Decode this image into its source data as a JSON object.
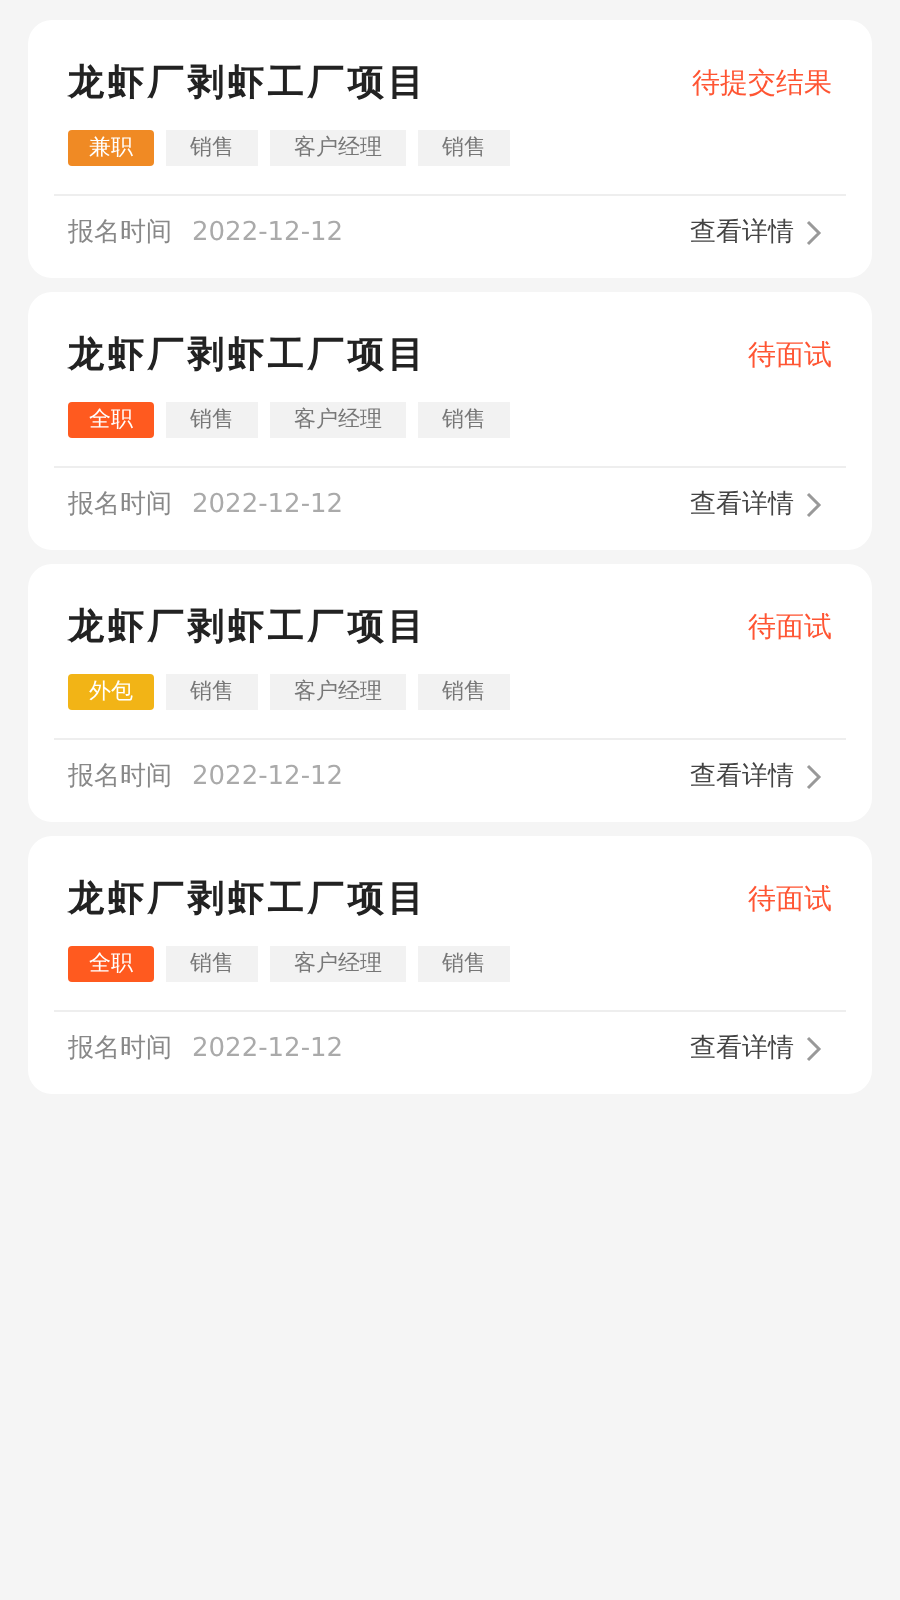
{
  "applications": [
    {
      "title": "龙虾厂剥虾工厂项目",
      "status": "待提交结果",
      "job_type": {
        "label": "兼职",
        "color": "#f08a24"
      },
      "tags": [
        "销售",
        "客户经理",
        "销售"
      ],
      "date_label": "报名时间",
      "date": "2022-12-12",
      "detail_link": "查看详情"
    },
    {
      "title": "龙虾厂剥虾工厂项目",
      "status": "待面试",
      "job_type": {
        "label": "全职",
        "color": "#ff5a1f"
      },
      "tags": [
        "销售",
        "客户经理",
        "销售"
      ],
      "date_label": "报名时间",
      "date": "2022-12-12",
      "detail_link": "查看详情"
    },
    {
      "title": "龙虾厂剥虾工厂项目",
      "status": "待面试",
      "job_type": {
        "label": "外包",
        "color": "#f2b416"
      },
      "tags": [
        "销售",
        "客户经理",
        "销售"
      ],
      "date_label": "报名时间",
      "date": "2022-12-12",
      "detail_link": "查看详情"
    },
    {
      "title": "龙虾厂剥虾工厂项目",
      "status": "待面试",
      "job_type": {
        "label": "全职",
        "color": "#ff5a1f"
      },
      "tags": [
        "销售",
        "客户经理",
        "销售"
      ],
      "date_label": "报名时间",
      "date": "2022-12-12",
      "detail_link": "查看详情"
    }
  ]
}
